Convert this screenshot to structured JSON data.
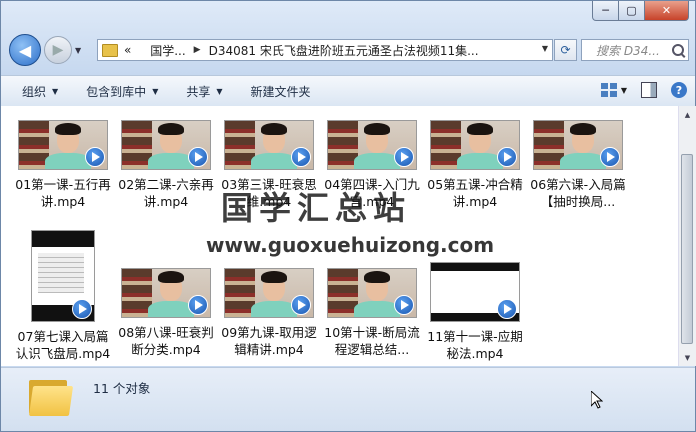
{
  "window": {
    "controls": {
      "minimize": "─",
      "maximize": "▢",
      "close": "✕"
    }
  },
  "address": {
    "crumbs": [
      "«",
      "国学...",
      "D34081 宋氏飞盘进阶班五元通圣占法视频11集..."
    ],
    "search_placeholder": "搜索 D34..."
  },
  "toolbar": {
    "organize": "组织",
    "include_library": "包含到库中",
    "share": "共享",
    "new_folder": "新建文件夹"
  },
  "files": [
    {
      "name": "01第一课-五行再讲.mp4",
      "kind": "person"
    },
    {
      "name": "02第二课-六亲再讲.mp4",
      "kind": "person"
    },
    {
      "name": "03第三课-旺衰思维.mp4",
      "kind": "person"
    },
    {
      "name": "04第四课-入门九宫.mp4",
      "kind": "person"
    },
    {
      "name": "05第五课-冲合精讲.mp4",
      "kind": "person"
    },
    {
      "name": "06第六课-入局篇【抽时换局...",
      "kind": "person"
    },
    {
      "name": "07第七课入局篇认识飞盘局.mp4",
      "kind": "doc"
    },
    {
      "name": "08第八课-旺衰判断分类.mp4",
      "kind": "person"
    },
    {
      "name": "09第九课-取用逻辑精讲.mp4",
      "kind": "person"
    },
    {
      "name": "10第十课-断局流程逻辑总结...",
      "kind": "person"
    },
    {
      "name": "11第十一课-应期秘法.mp4",
      "kind": "wide"
    }
  ],
  "watermark": {
    "line1": "国学汇总站",
    "line2": "www.guoxuehuizong.com"
  },
  "status": {
    "count": "11 个对象"
  },
  "icons": {
    "back": "back-arrow-icon",
    "forward": "forward-arrow-icon",
    "refresh": "refresh-icon",
    "search": "search-icon",
    "play": "play-icon",
    "folder": "folder-icon"
  }
}
